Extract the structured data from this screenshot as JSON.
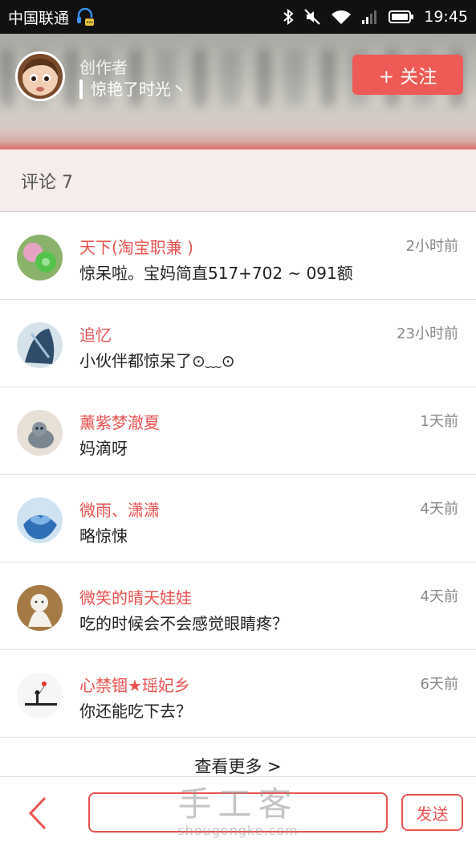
{
  "status_bar": {
    "carrier": "中国联通",
    "time": "19:45"
  },
  "author": {
    "label": "创作者",
    "name": "惊艳了时光丶",
    "follow_label": "+ 关注"
  },
  "comments_header": "评论 7",
  "comments": [
    {
      "name": "天下(淘宝职兼 )",
      "text": "惊呆啦。宝妈简直517+702 ~ 091额",
      "time": "2小时前"
    },
    {
      "name": "追忆",
      "text": "小伙伴都惊呆了⊙﹏⊙",
      "time": "23小时前"
    },
    {
      "name": "薰紫梦澈夏",
      "text": "妈滴呀",
      "time": "1天前"
    },
    {
      "name": "微雨、潇潇",
      "text": "略惊悚",
      "time": "4天前"
    },
    {
      "name": "微笑的晴天娃娃",
      "text": "吃的时候会不会感觉眼睛疼？",
      "time": "4天前"
    },
    {
      "name": "心禁锢★瑶妃乡",
      "text": "你还能吃下去？",
      "time": "6天前"
    }
  ],
  "see_more": "查看更多 >",
  "bottom_bar": {
    "input_value": "",
    "send_label": "发送"
  },
  "watermark": {
    "main": "手工客",
    "sub": "shougongke.com"
  },
  "colors": {
    "accent": "#e9534f",
    "status_bar": "#111111",
    "comments_header_bg": "#f6ecec"
  },
  "icons": [
    "headset-notification-icon",
    "bluetooth-icon",
    "mute-icon",
    "wifi-icon",
    "signal-icon",
    "battery-icon",
    "back-chevron-icon"
  ]
}
